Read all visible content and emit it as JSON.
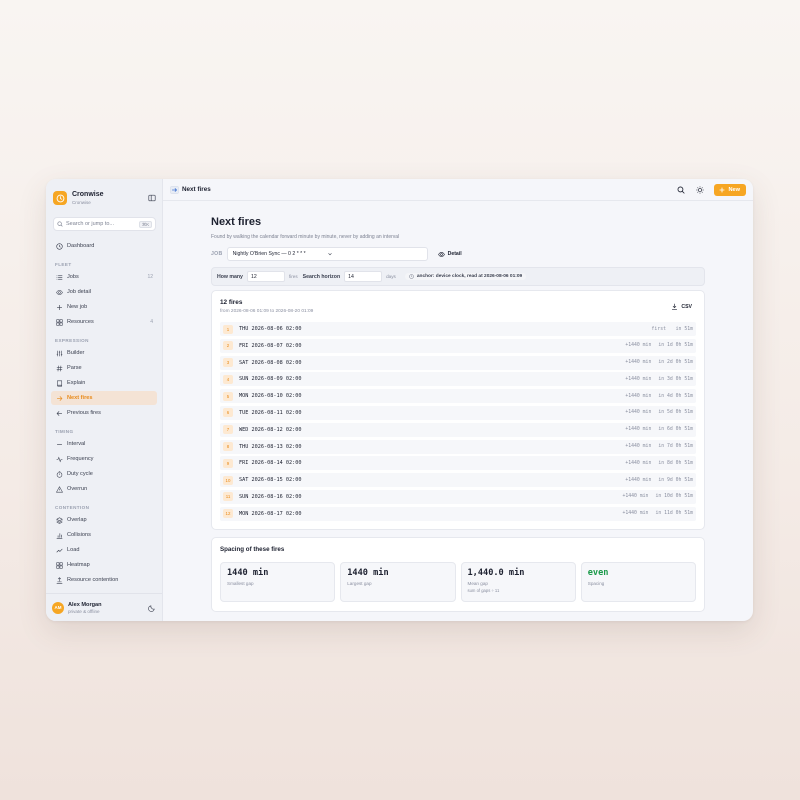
{
  "app": {
    "name": "Cronwise",
    "subtitle": "Cronwise"
  },
  "search": {
    "placeholder": "Search or jump to...",
    "shortcut": "⌘K"
  },
  "sidebar": {
    "dashboard": "Dashboard",
    "sections": {
      "fleet": "FLEET",
      "expression": "EXPRESSION",
      "timing": "TIMING",
      "contention": "CONTENTION"
    },
    "fleet": [
      {
        "label": "Jobs",
        "count": "12"
      },
      {
        "label": "Job detail",
        "count": ""
      },
      {
        "label": "New job",
        "count": ""
      },
      {
        "label": "Resources",
        "count": "4"
      }
    ],
    "expression": [
      {
        "label": "Builder"
      },
      {
        "label": "Parse"
      },
      {
        "label": "Explain"
      },
      {
        "label": "Next fires"
      },
      {
        "label": "Previous fires"
      }
    ],
    "timing": [
      {
        "label": "Interval"
      },
      {
        "label": "Frequency"
      },
      {
        "label": "Duty cycle"
      },
      {
        "label": "Overrun"
      }
    ],
    "contention": [
      {
        "label": "Overlap"
      },
      {
        "label": "Collisions"
      },
      {
        "label": "Load"
      },
      {
        "label": "Heatmap"
      },
      {
        "label": "Resource contention"
      }
    ]
  },
  "user": {
    "initials": "AM",
    "name": "Alex Morgan",
    "status": "private & offline"
  },
  "topbar": {
    "title": "Next fires",
    "new_label": "New"
  },
  "page": {
    "title": "Next fires",
    "subtitle": "Found by walking the calendar forward minute by minute, never by adding an interval",
    "job_label": "JOB",
    "job_value": "Nightly O'Brien Sync — 0 2 * * *",
    "detail_label": "Detail"
  },
  "params": {
    "how_many_label": "How many",
    "how_many_value": "12",
    "how_many_unit": "fires",
    "horizon_label": "Search horizon",
    "horizon_value": "14",
    "horizon_unit": "days",
    "anchor_text": "anchor: device clock, read at 2026-08-06 01:09"
  },
  "fires": {
    "title": "12 fires",
    "range": "from 2026-08-06 01:09 to 2026-08-20 01:09",
    "csv_label": "CSV",
    "rows": [
      {
        "n": "1",
        "dt": "THU 2026-08-06 02:00",
        "gap": "first",
        "in": "in 51m"
      },
      {
        "n": "2",
        "dt": "FRI 2026-08-07 02:00",
        "gap": "+1440 min",
        "in": "in 1d 0h 51m"
      },
      {
        "n": "3",
        "dt": "SAT 2026-08-08 02:00",
        "gap": "+1440 min",
        "in": "in 2d 0h 51m"
      },
      {
        "n": "4",
        "dt": "SUN 2026-08-09 02:00",
        "gap": "+1440 min",
        "in": "in 3d 0h 51m"
      },
      {
        "n": "5",
        "dt": "MON 2026-08-10 02:00",
        "gap": "+1440 min",
        "in": "in 4d 0h 51m"
      },
      {
        "n": "6",
        "dt": "TUE 2026-08-11 02:00",
        "gap": "+1440 min",
        "in": "in 5d 0h 51m"
      },
      {
        "n": "7",
        "dt": "WED 2026-08-12 02:00",
        "gap": "+1440 min",
        "in": "in 6d 0h 51m"
      },
      {
        "n": "8",
        "dt": "THU 2026-08-13 02:00",
        "gap": "+1440 min",
        "in": "in 7d 0h 51m"
      },
      {
        "n": "9",
        "dt": "FRI 2026-08-14 02:00",
        "gap": "+1440 min",
        "in": "in 8d 0h 51m"
      },
      {
        "n": "10",
        "dt": "SAT 2026-08-15 02:00",
        "gap": "+1440 min",
        "in": "in 9d 0h 51m"
      },
      {
        "n": "11",
        "dt": "SUN 2026-08-16 02:00",
        "gap": "+1440 min",
        "in": "in 10d 0h 51m"
      },
      {
        "n": "12",
        "dt": "MON 2026-08-17 02:00",
        "gap": "+1440 min",
        "in": "in 11d 0h 51m"
      }
    ]
  },
  "spacing": {
    "title": "Spacing of these fires",
    "stats": [
      {
        "value": "1440 min",
        "label": "Smallest gap",
        "note": ""
      },
      {
        "value": "1440 min",
        "label": "Largest gap",
        "note": ""
      },
      {
        "value": "1,440.0 min",
        "label": "Mean gap",
        "note": "sum of gaps ÷ 11"
      },
      {
        "value": "even",
        "label": "Spacing",
        "note": ""
      }
    ]
  },
  "colors": {
    "accent": "#f6a623",
    "accent_text": "#e88a1a",
    "success": "#1c9a4a"
  }
}
